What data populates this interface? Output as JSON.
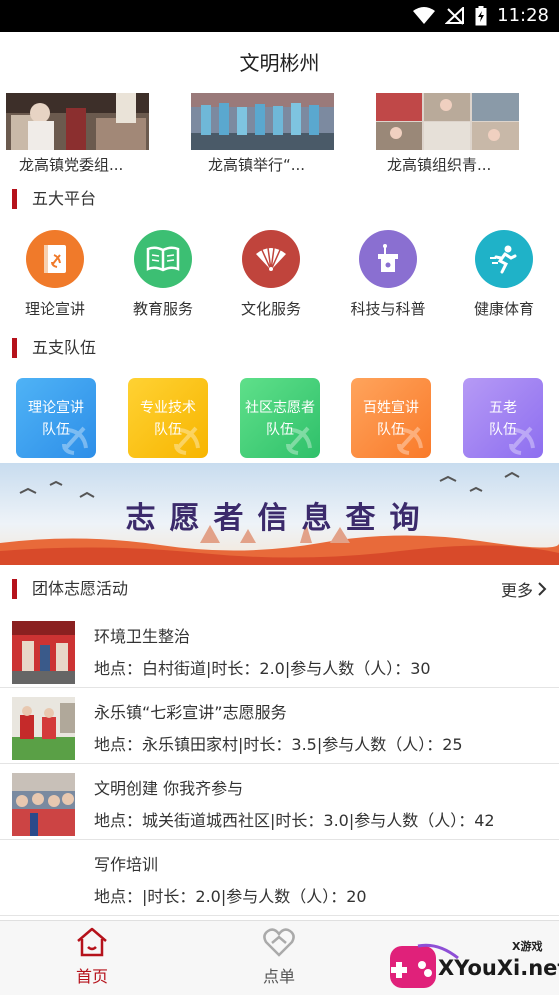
{
  "status_bar": {
    "time": "11:28"
  },
  "app": {
    "title": "文明彬州"
  },
  "news": [
    {
      "caption": "龙高镇党委组..."
    },
    {
      "caption": "龙高镇举行“..."
    },
    {
      "caption": "龙高镇组织青..."
    }
  ],
  "platforms": {
    "title": "五大平台",
    "items": [
      {
        "label": "理论宣讲",
        "icon": "party-book-icon",
        "color": "#f07a2a"
      },
      {
        "label": "教育服务",
        "icon": "open-book-icon",
        "color": "#3cbf73"
      },
      {
        "label": "文化服务",
        "icon": "fan-icon",
        "color": "#c0443c"
      },
      {
        "label": "科技与科普",
        "icon": "podium-icon",
        "color": "#8a6fd1"
      },
      {
        "label": "健康体育",
        "icon": "runner-icon",
        "color": "#1fb2c8"
      }
    ]
  },
  "teams": {
    "title": "五支队伍",
    "items": [
      {
        "line1": "理论宣讲",
        "line2": "队伍",
        "color_from": "#4fb3f6",
        "color_to": "#2d8ee8"
      },
      {
        "line1": "专业技术",
        "line2": "队伍",
        "color_from": "#ffd233",
        "color_to": "#f7b500"
      },
      {
        "line1": "社区志愿者",
        "line2": "队伍",
        "color_from": "#5fe08a",
        "color_to": "#2fc06a"
      },
      {
        "line1": "百姓宣讲",
        "line2": "队伍",
        "color_from": "#ffa45c",
        "color_to": "#f97a2a"
      },
      {
        "line1": "五老",
        "line2": "队伍",
        "color_from": "#b69af5",
        "color_to": "#8d6ef0"
      }
    ]
  },
  "banner": {
    "text": "志愿者信息查询"
  },
  "activities": {
    "title": "团体志愿活动",
    "more_label": "更多",
    "items": [
      {
        "title": "环境卫生整治",
        "info": "地点：白村街道|时长：2.0|参与人数（人）：30"
      },
      {
        "title": "永乐镇“七彩宣讲”志愿服务",
        "info": "地点：永乐镇田家村|时长：3.5|参与人数（人）：25"
      },
      {
        "title": "文明创建 你我齐参与",
        "info": "地点：城关街道城西社区|时长：3.0|参与人数（人）：42"
      },
      {
        "title": "写作培训",
        "info": "地点：|时长：2.0|参与人数（人）：20"
      }
    ]
  },
  "bottom_nav": {
    "items": [
      {
        "label": "首页",
        "active": true
      },
      {
        "label": "点单",
        "active": false
      }
    ]
  },
  "watermark": {
    "site": "XYouXi.net",
    "small": "X游戏"
  },
  "colors": {
    "accent": "#b5121b"
  }
}
